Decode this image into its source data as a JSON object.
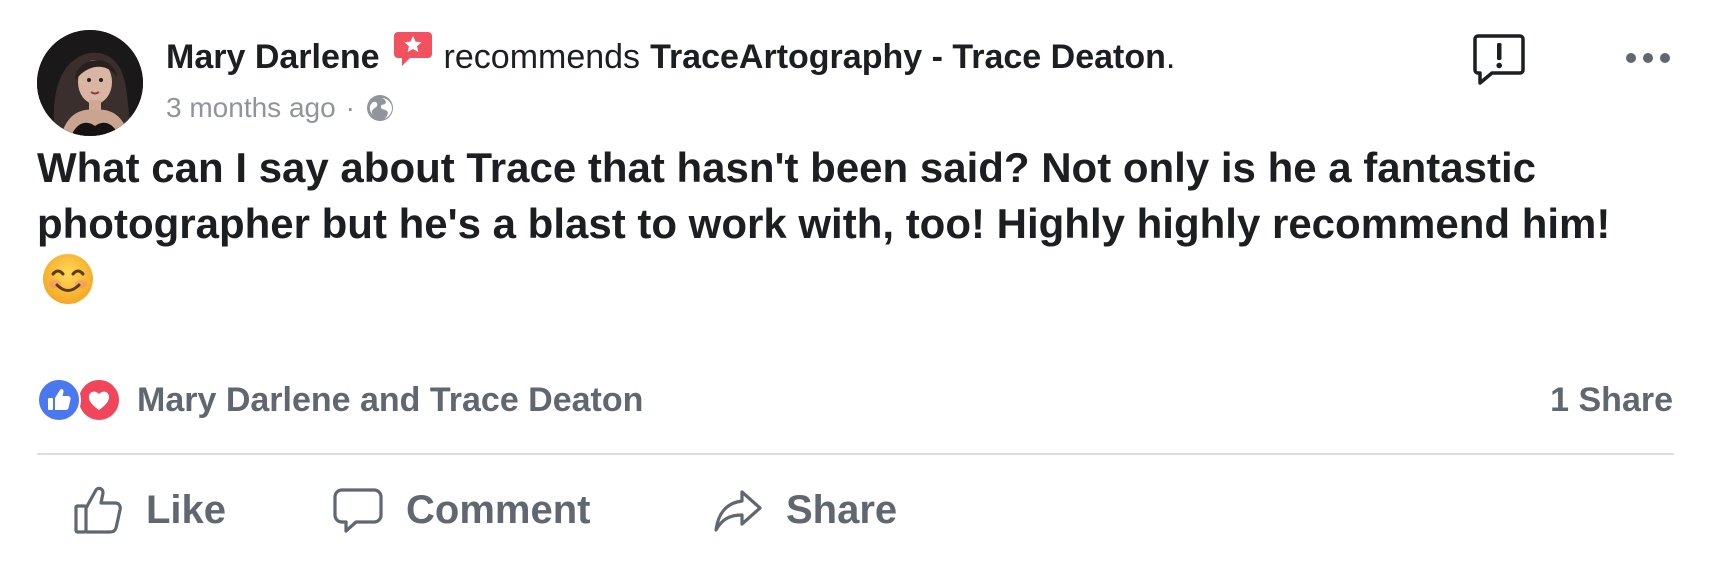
{
  "post": {
    "author": "Mary Darlene",
    "verb": "recommends",
    "page": "TraceArtography - Trace Deaton",
    "period": ".",
    "timestamp": "3 months ago",
    "separator": "·",
    "audience_icon": "globe-icon",
    "text": "What can I say about Trace that hasn't been said? Not only is he a fantastic photographer but he's a blast to work with, too! Highly highly recommend him!",
    "emoji": "smiling-face-emoji"
  },
  "header_icons": {
    "badge": "recommendation-badge-icon",
    "report": "report-icon",
    "more": "more-options-icon"
  },
  "reactions": {
    "icons": [
      "like-reaction-icon",
      "love-reaction-icon"
    ],
    "names": "Mary Darlene and Trace Deaton",
    "share_count": "1 Share"
  },
  "actions": {
    "like": "Like",
    "comment": "Comment",
    "share": "Share"
  },
  "colors": {
    "text": "#1c1e21",
    "secondary": "#606770",
    "meta": "#90949c",
    "like_blue": "#4a78f0",
    "love_red": "#f0455b",
    "badge_red": "#f2515f",
    "divider": "#dadde1"
  }
}
